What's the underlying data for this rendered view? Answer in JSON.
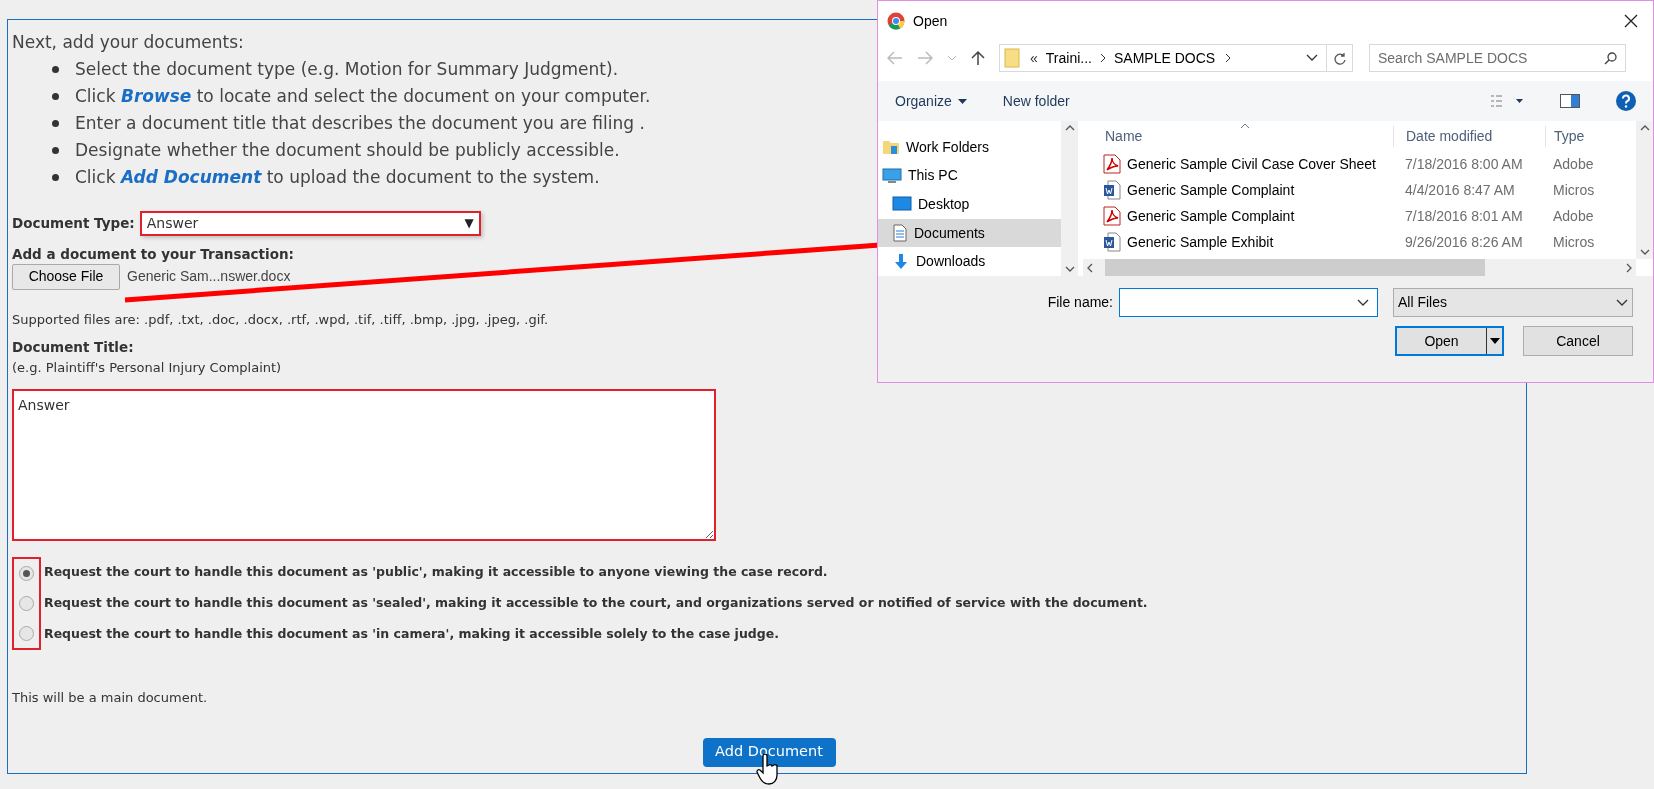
{
  "instructions": {
    "heading": "Next, add your documents:",
    "items": [
      "Select the document type (e.g. Motion for Summary Judgment).",
      "Click **Browse** to locate and select the document on your computer.",
      "Enter a document title that describes the document you are filing .",
      "Designate whether the document should be publicly accessible.",
      "Click **Add Document** to upload the document to the system."
    ]
  },
  "document_type": {
    "label": "Document Type:",
    "value": "Answer",
    "arrow": "▼"
  },
  "file_upload": {
    "label": "Add a document to your Transaction:",
    "button": "Choose File",
    "file_name": "Generic Sam...nswer.docx",
    "note": "Supported files are: .pdf, .txt, .doc, .docx, .rtf, .wpd, .tif, .tiff, .bmp, .jpg, .jpeg, .gif."
  },
  "document_title": {
    "label": "Document Title:",
    "hint": "(e.g. Plaintiff's Personal Injury Complaint)",
    "value": "Answer"
  },
  "access_options": [
    {
      "label": "Request the court to handle this document as 'public', making it accessible to anyone viewing the case record.",
      "selected": true
    },
    {
      "label": "Request the court to handle this document as 'sealed', making it accessible to the court, and organizations served or notified of service with the document.",
      "selected": false
    },
    {
      "label": "Request the court to handle this document as 'in camera', making it accessible solely to the case judge.",
      "selected": false
    }
  ],
  "main_note": "This will be a main document.",
  "add_button": "Add Document",
  "dialog": {
    "title": "Open",
    "path": [
      "«",
      "Traini...",
      "SAMPLE DOCS"
    ],
    "search_placeholder": "Search SAMPLE DOCS",
    "toolbar": [
      "Organize",
      "New folder"
    ],
    "nav_items": [
      {
        "label": "Work Folders",
        "kind": "workfolders",
        "selected": false
      },
      {
        "label": "This PC",
        "kind": "pc",
        "selected": false
      },
      {
        "label": "Desktop",
        "kind": "desktop",
        "selected": false
      },
      {
        "label": "Documents",
        "kind": "documents",
        "selected": true
      },
      {
        "label": "Downloads",
        "kind": "downloads",
        "selected": false
      }
    ],
    "columns": [
      "Name",
      "Date modified",
      "Type"
    ],
    "files": [
      {
        "name": "Generic Sample Civil Case Cover Sheet",
        "date": "7/18/2016 8:00 AM",
        "type": "Adobe",
        "kind": "pdf"
      },
      {
        "name": "Generic Sample Complaint",
        "date": "4/4/2016 8:47 AM",
        "type": "Micros",
        "kind": "word"
      },
      {
        "name": "Generic Sample Complaint",
        "date": "7/18/2016 8:01 AM",
        "type": "Adobe",
        "kind": "pdf"
      },
      {
        "name": "Generic Sample Exhibit",
        "date": "9/26/2016 8:26 AM",
        "type": "Micros",
        "kind": "word"
      }
    ],
    "file_name_label": "File name:",
    "filter": "All Files",
    "open_button": "Open",
    "cancel_button": "Cancel"
  }
}
